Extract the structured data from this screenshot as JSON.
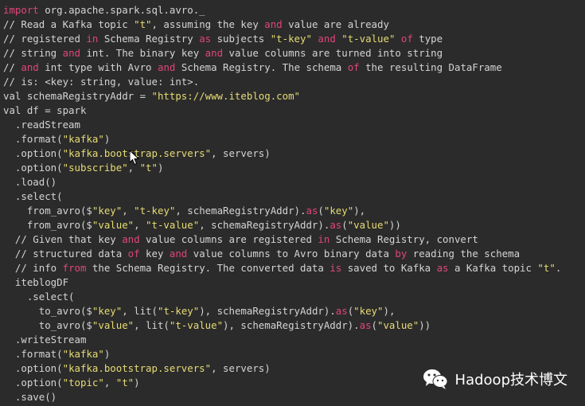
{
  "editor": {
    "lines": [
      [
        {
          "t": "import",
          "c": "kw"
        },
        {
          "t": " org.apache.spark.sql.avro._",
          "c": "plain"
        }
      ],
      [
        {
          "t": "// Read a Kafka topic ",
          "c": "plain"
        },
        {
          "t": "\"t\"",
          "c": "str"
        },
        {
          "t": ", assuming the key ",
          "c": "plain"
        },
        {
          "t": "and",
          "c": "kw"
        },
        {
          "t": " value are already",
          "c": "plain"
        }
      ],
      [
        {
          "t": "// registered ",
          "c": "plain"
        },
        {
          "t": "in",
          "c": "kw"
        },
        {
          "t": " Schema Registry ",
          "c": "plain"
        },
        {
          "t": "as",
          "c": "kw"
        },
        {
          "t": " subjects ",
          "c": "plain"
        },
        {
          "t": "\"t-key\"",
          "c": "str"
        },
        {
          "t": " ",
          "c": "plain"
        },
        {
          "t": "and",
          "c": "kw"
        },
        {
          "t": " ",
          "c": "plain"
        },
        {
          "t": "\"t-value\"",
          "c": "str"
        },
        {
          "t": " ",
          "c": "plain"
        },
        {
          "t": "of",
          "c": "kw"
        },
        {
          "t": " type",
          "c": "plain"
        }
      ],
      [
        {
          "t": "// string ",
          "c": "plain"
        },
        {
          "t": "and",
          "c": "kw"
        },
        {
          "t": " int. The binary key ",
          "c": "plain"
        },
        {
          "t": "and",
          "c": "kw"
        },
        {
          "t": " value columns are turned into string",
          "c": "plain"
        }
      ],
      [
        {
          "t": "// ",
          "c": "plain"
        },
        {
          "t": "and",
          "c": "kw"
        },
        {
          "t": " int type with Avro ",
          "c": "plain"
        },
        {
          "t": "and",
          "c": "kw"
        },
        {
          "t": " Schema Registry. The schema ",
          "c": "plain"
        },
        {
          "t": "of",
          "c": "kw"
        },
        {
          "t": " the resulting DataFrame",
          "c": "plain"
        }
      ],
      [
        {
          "t": "// is: <key: string, value: int>.",
          "c": "plain"
        }
      ],
      [
        {
          "t": "val schemaRegistryAddr = ",
          "c": "plain"
        },
        {
          "t": "\"https://www.iteblog.com\"",
          "c": "str"
        }
      ],
      [
        {
          "t": "val df = spark",
          "c": "plain"
        }
      ],
      [
        {
          "t": "  .readStream",
          "c": "plain"
        }
      ],
      [
        {
          "t": "  .format(",
          "c": "plain"
        },
        {
          "t": "\"kafka\"",
          "c": "str"
        },
        {
          "t": ")",
          "c": "plain"
        }
      ],
      [
        {
          "t": "  .option(",
          "c": "plain"
        },
        {
          "t": "\"kafka.bootstrap.servers\"",
          "c": "str"
        },
        {
          "t": ", servers)",
          "c": "plain"
        }
      ],
      [
        {
          "t": "  .option(",
          "c": "plain"
        },
        {
          "t": "\"subscribe\"",
          "c": "str"
        },
        {
          "t": ", ",
          "c": "plain"
        },
        {
          "t": "\"t\"",
          "c": "str"
        },
        {
          "t": ")",
          "c": "plain"
        }
      ],
      [
        {
          "t": "  .load()",
          "c": "plain"
        }
      ],
      [
        {
          "t": "  .select(",
          "c": "plain"
        }
      ],
      [
        {
          "t": "    from_avro($",
          "c": "plain"
        },
        {
          "t": "\"key\"",
          "c": "str"
        },
        {
          "t": ", ",
          "c": "plain"
        },
        {
          "t": "\"t-key\"",
          "c": "str"
        },
        {
          "t": ", schemaRegistryAddr).",
          "c": "plain"
        },
        {
          "t": "as",
          "c": "kw"
        },
        {
          "t": "(",
          "c": "plain"
        },
        {
          "t": "\"key\"",
          "c": "str"
        },
        {
          "t": "),",
          "c": "plain"
        }
      ],
      [
        {
          "t": "    from_avro($",
          "c": "plain"
        },
        {
          "t": "\"value\"",
          "c": "str"
        },
        {
          "t": ", ",
          "c": "plain"
        },
        {
          "t": "\"t-value\"",
          "c": "str"
        },
        {
          "t": ", schemaRegistryAddr).",
          "c": "plain"
        },
        {
          "t": "as",
          "c": "kw"
        },
        {
          "t": "(",
          "c": "plain"
        },
        {
          "t": "\"value\"",
          "c": "str"
        },
        {
          "t": "))",
          "c": "plain"
        }
      ],
      [
        {
          "t": "  // Given that key ",
          "c": "plain"
        },
        {
          "t": "and",
          "c": "kw"
        },
        {
          "t": " value columns are registered ",
          "c": "plain"
        },
        {
          "t": "in",
          "c": "kw"
        },
        {
          "t": " Schema Registry, convert",
          "c": "plain"
        }
      ],
      [
        {
          "t": "  // structured data ",
          "c": "plain"
        },
        {
          "t": "of",
          "c": "kw"
        },
        {
          "t": " key ",
          "c": "plain"
        },
        {
          "t": "and",
          "c": "kw"
        },
        {
          "t": " value columns to Avro binary data ",
          "c": "plain"
        },
        {
          "t": "by",
          "c": "kw"
        },
        {
          "t": " reading the schema",
          "c": "plain"
        }
      ],
      [
        {
          "t": "  // info ",
          "c": "plain"
        },
        {
          "t": "from",
          "c": "kw"
        },
        {
          "t": " the Schema Registry. The converted data ",
          "c": "plain"
        },
        {
          "t": "is",
          "c": "kw"
        },
        {
          "t": " saved to Kafka ",
          "c": "plain"
        },
        {
          "t": "as",
          "c": "kw"
        },
        {
          "t": " a Kafka topic ",
          "c": "plain"
        },
        {
          "t": "\"t\"",
          "c": "str"
        },
        {
          "t": ".",
          "c": "plain"
        }
      ],
      [
        {
          "t": "  iteblogDF",
          "c": "plain"
        }
      ],
      [
        {
          "t": "    .select(",
          "c": "plain"
        }
      ],
      [
        {
          "t": "      to_avro($",
          "c": "plain"
        },
        {
          "t": "\"key\"",
          "c": "str"
        },
        {
          "t": ", lit(",
          "c": "plain"
        },
        {
          "t": "\"t-key\"",
          "c": "str"
        },
        {
          "t": "), schemaRegistryAddr).",
          "c": "plain"
        },
        {
          "t": "as",
          "c": "kw"
        },
        {
          "t": "(",
          "c": "plain"
        },
        {
          "t": "\"key\"",
          "c": "str"
        },
        {
          "t": "),",
          "c": "plain"
        }
      ],
      [
        {
          "t": "      to_avro($",
          "c": "plain"
        },
        {
          "t": "\"value\"",
          "c": "str"
        },
        {
          "t": ", lit(",
          "c": "plain"
        },
        {
          "t": "\"t-value\"",
          "c": "str"
        },
        {
          "t": "), schemaRegistryAddr).",
          "c": "plain"
        },
        {
          "t": "as",
          "c": "kw"
        },
        {
          "t": "(",
          "c": "plain"
        },
        {
          "t": "\"value\"",
          "c": "str"
        },
        {
          "t": "))",
          "c": "plain"
        }
      ],
      [
        {
          "t": "  .writeStream",
          "c": "plain"
        }
      ],
      [
        {
          "t": "  .format(",
          "c": "plain"
        },
        {
          "t": "\"kafka\"",
          "c": "str"
        },
        {
          "t": ")",
          "c": "plain"
        }
      ],
      [
        {
          "t": "  .option(",
          "c": "plain"
        },
        {
          "t": "\"kafka.bootstrap.servers\"",
          "c": "str"
        },
        {
          "t": ", servers)",
          "c": "plain"
        }
      ],
      [
        {
          "t": "  .option(",
          "c": "plain"
        },
        {
          "t": "\"topic\"",
          "c": "str"
        },
        {
          "t": ", ",
          "c": "plain"
        },
        {
          "t": "\"t\"",
          "c": "str"
        },
        {
          "t": ")",
          "c": "plain"
        }
      ],
      [
        {
          "t": "  .save()",
          "c": "plain"
        }
      ]
    ]
  },
  "watermark": {
    "icon": "wechat-icon",
    "text": "Hadoop技术博文"
  },
  "colors": {
    "background": "#2b2b2b",
    "keyword": "#e0457b",
    "string": "#e6db74",
    "plain": "#d4d4d4"
  }
}
